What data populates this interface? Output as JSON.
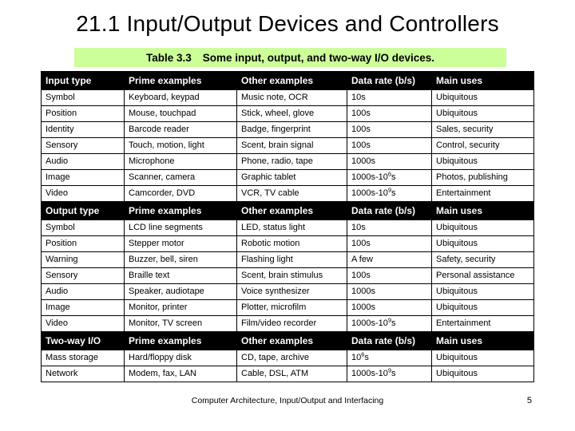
{
  "slide": {
    "title": "21.1  Input/Output Devices and Controllers",
    "caption_number": "Table 3.3",
    "caption_text": "Some input, output, and two-way I/O devices.",
    "caption_bg": "#ccff99",
    "footer_text": "Computer Architecture, Input/Output and Interfacing",
    "page_number": "5"
  },
  "table": {
    "columns": [
      "Input type",
      "Prime examples",
      "Other examples",
      "Data rate (b/s)",
      "Main uses"
    ],
    "sections": [
      {
        "header": [
          "Input type",
          "Prime examples",
          "Other examples",
          "Data rate (b/s)",
          "Main uses"
        ],
        "rows": [
          [
            "Symbol",
            "Keyboard, keypad",
            "Music note, OCR",
            "10s",
            "Ubiquitous"
          ],
          [
            "Position",
            "Mouse, touchpad",
            "Stick, wheel, glove",
            "100s",
            "Ubiquitous"
          ],
          [
            "Identity",
            "Barcode reader",
            "Badge, fingerprint",
            "100s",
            "Sales, security"
          ],
          [
            "Sensory",
            "Touch, motion, light",
            "Scent, brain signal",
            "100s",
            "Control, security"
          ],
          [
            "Audio",
            "Microphone",
            "Phone, radio, tape",
            "1000s",
            "Ubiquitous"
          ],
          [
            "Image",
            "Scanner, camera",
            "Graphic tablet",
            "1000s-10^6s",
            "Photos, publishing"
          ],
          [
            "Video",
            "Camcorder, DVD",
            "VCR, TV cable",
            "1000s-10^9s",
            "Entertainment"
          ]
        ]
      },
      {
        "header": [
          "Output type",
          "Prime examples",
          "Other examples",
          "Data rate (b/s)",
          "Main uses"
        ],
        "rows": [
          [
            "Symbol",
            "LCD line segments",
            "LED, status light",
            "10s",
            "Ubiquitous"
          ],
          [
            "Position",
            "Stepper motor",
            "Robotic motion",
            "100s",
            "Ubiquitous"
          ],
          [
            "Warning",
            "Buzzer, bell, siren",
            "Flashing light",
            "A few",
            "Safety, security"
          ],
          [
            "Sensory",
            "Braille text",
            "Scent, brain stimulus",
            "100s",
            "Personal assistance"
          ],
          [
            "Audio",
            "Speaker, audiotape",
            "Voice synthesizer",
            "1000s",
            "Ubiquitous"
          ],
          [
            "Image",
            "Monitor, printer",
            "Plotter, microfilm",
            "1000s",
            "Ubiquitous"
          ],
          [
            "Video",
            "Monitor, TV screen",
            "Film/video recorder",
            "1000s-10^9s",
            "Entertainment"
          ]
        ]
      },
      {
        "header": [
          "Two-way I/O",
          "Prime examples",
          "Other examples",
          "Data rate (b/s)",
          "Main uses"
        ],
        "rows": [
          [
            "Mass storage",
            "Hard/floppy disk",
            "CD, tape, archive",
            "10^6s",
            "Ubiquitous"
          ],
          [
            "Network",
            "Modem, fax, LAN",
            "Cable, DSL, ATM",
            "1000s-10^9s",
            "Ubiquitous"
          ]
        ]
      }
    ]
  }
}
